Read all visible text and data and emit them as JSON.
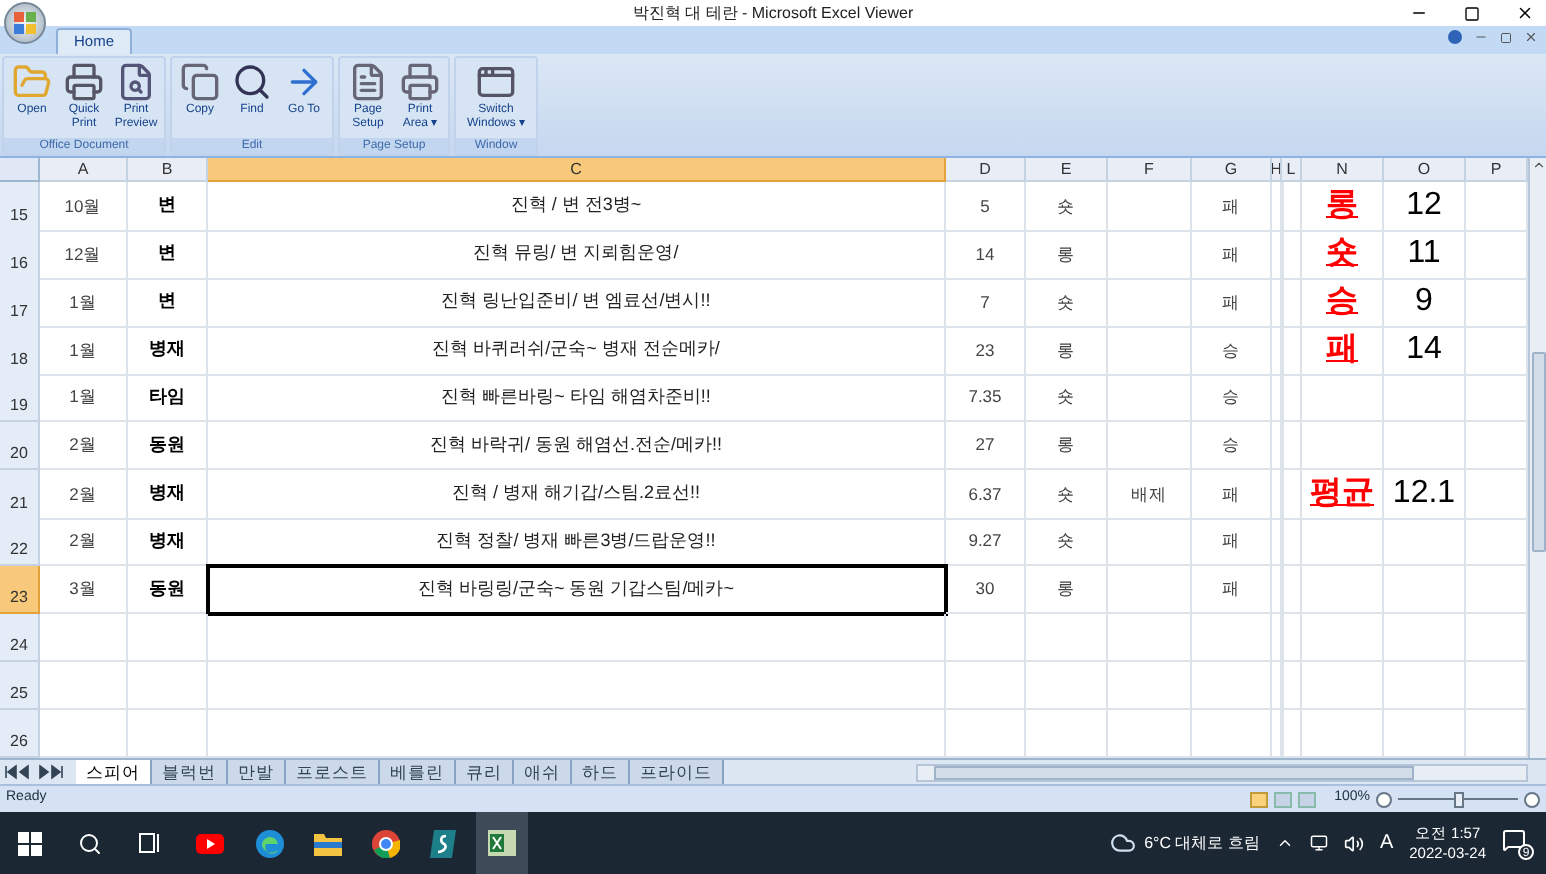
{
  "window": {
    "title": "박진혁 대 테란 - Microsoft Excel Viewer"
  },
  "tabs": [
    {
      "label": "Home",
      "selected": true
    }
  ],
  "ribbon": [
    {
      "label": "Office Document",
      "buttons": [
        {
          "kind": "open",
          "label": "Open"
        },
        {
          "kind": "quickprint",
          "label": "Quick Print"
        },
        {
          "kind": "preview",
          "label": "Print Preview"
        }
      ]
    },
    {
      "label": "Edit",
      "buttons": [
        {
          "kind": "copy",
          "label": "Copy"
        },
        {
          "kind": "find",
          "label": "Find"
        },
        {
          "kind": "goto",
          "label": "Go To"
        }
      ]
    },
    {
      "label": "Page Setup",
      "buttons": [
        {
          "kind": "pagesetup",
          "label": "Page Setup"
        },
        {
          "kind": "printarea",
          "label": "Print Area ▾"
        }
      ]
    },
    {
      "label": "Window",
      "buttons": [
        {
          "kind": "switch",
          "label": "Switch Windows ▾"
        }
      ]
    }
  ],
  "columns": [
    {
      "label": "A",
      "selected": false
    },
    {
      "label": "B",
      "selected": false
    },
    {
      "label": "C",
      "selected": true
    },
    {
      "label": "D",
      "selected": false
    },
    {
      "label": "E",
      "selected": false
    },
    {
      "label": "F",
      "selected": false
    },
    {
      "label": "G",
      "selected": false
    },
    {
      "label": "H",
      "selected": false
    },
    {
      "label": "L",
      "selected": false
    },
    {
      "label": "N",
      "selected": false
    },
    {
      "label": "O",
      "selected": false
    },
    {
      "label": "P",
      "selected": false
    }
  ],
  "rows": [
    {
      "number": "15",
      "selected": false,
      "col_a": "10월",
      "col_b": "변",
      "col_c": "진혁 / 변 전3병~",
      "col_d": "5",
      "col_e": "숏",
      "col_g": "패",
      "col_n": "롱",
      "col_o": "12"
    },
    {
      "number": "16",
      "selected": false,
      "col_a": "12월",
      "col_b": "변",
      "col_c": "진혁 뮤링/ 변 지뢰힘운영/",
      "col_d": "14",
      "col_e": "롱",
      "col_g": "패",
      "col_n": "숏",
      "col_o": "11"
    },
    {
      "number": "17",
      "selected": false,
      "col_a": "1월",
      "col_b": "변",
      "col_c": "진혁 링난입준비/ 변 엠료선/변시!!",
      "col_d": "7",
      "col_e": "숏",
      "col_g": "패",
      "col_n": "승",
      "col_o": "9"
    },
    {
      "number": "18",
      "selected": false,
      "col_a": "1월",
      "col_b": "병재",
      "col_c": "진혁 바퀴러쉬/군숙~ 병재 전순메카/",
      "col_d": "23",
      "col_e": "롱",
      "col_g": "승",
      "col_n": "패",
      "col_o": "14"
    },
    {
      "number": "19",
      "selected": false,
      "col_a": "1월",
      "col_b": "타임",
      "col_c": "진혁 빠른바링~ 타임 해염차준비!!",
      "col_d": "7.35",
      "col_e": "숏",
      "col_g": "승"
    },
    {
      "number": "20",
      "selected": false,
      "col_a": "2월",
      "col_b": "동원",
      "col_c": "진혁 바락귀/ 동원 해염선.전순/메카!!",
      "col_d": "27",
      "col_e": "롱",
      "col_g": "승"
    },
    {
      "number": "21",
      "selected": false,
      "col_a": "2월",
      "col_b": "병재",
      "col_c": "진혁 / 병재 해기갑/스팀.2료선!!",
      "col_d": "6.37",
      "col_e": "숏",
      "col_f": "배제",
      "col_g": "패",
      "col_n": "평균",
      "col_o": "12.1"
    },
    {
      "number": "22",
      "selected": false,
      "col_a": "2월",
      "col_b": "병재",
      "col_c": "진혁 정찰/ 병재 빠른3병/드랍운영!!",
      "col_d": "9.27",
      "col_e": "숏",
      "col_g": "패"
    },
    {
      "number": "23",
      "selected": true,
      "col_a": "3월",
      "col_b": "동원",
      "col_c": "진혁 바링링/군숙~ 동원 기갑스팀/메카~",
      "col_d": "30",
      "col_e": "롱",
      "col_g": "패"
    },
    {
      "number": "24",
      "selected": false
    },
    {
      "number": "25",
      "selected": false
    },
    {
      "number": "26",
      "selected": false
    }
  ],
  "sheets": [
    {
      "label": "스피어",
      "selected": true
    },
    {
      "label": "블럭번",
      "selected": false
    },
    {
      "label": "만발",
      "selected": false
    },
    {
      "label": "프로스트",
      "selected": false
    },
    {
      "label": "베를린",
      "selected": false
    },
    {
      "label": "큐리",
      "selected": false
    },
    {
      "label": "애쉬",
      "selected": false
    },
    {
      "label": "하드",
      "selected": false
    },
    {
      "label": "프라이드",
      "selected": false
    }
  ],
  "status_bar": {
    "text": "Ready",
    "zoom": "100%",
    "level": 0.5
  },
  "taskbar": {
    "weather": "6°C 대체로 흐림",
    "ime": "A",
    "time": "오전 1:57",
    "date": "2022-03-24",
    "notifications": "9"
  }
}
